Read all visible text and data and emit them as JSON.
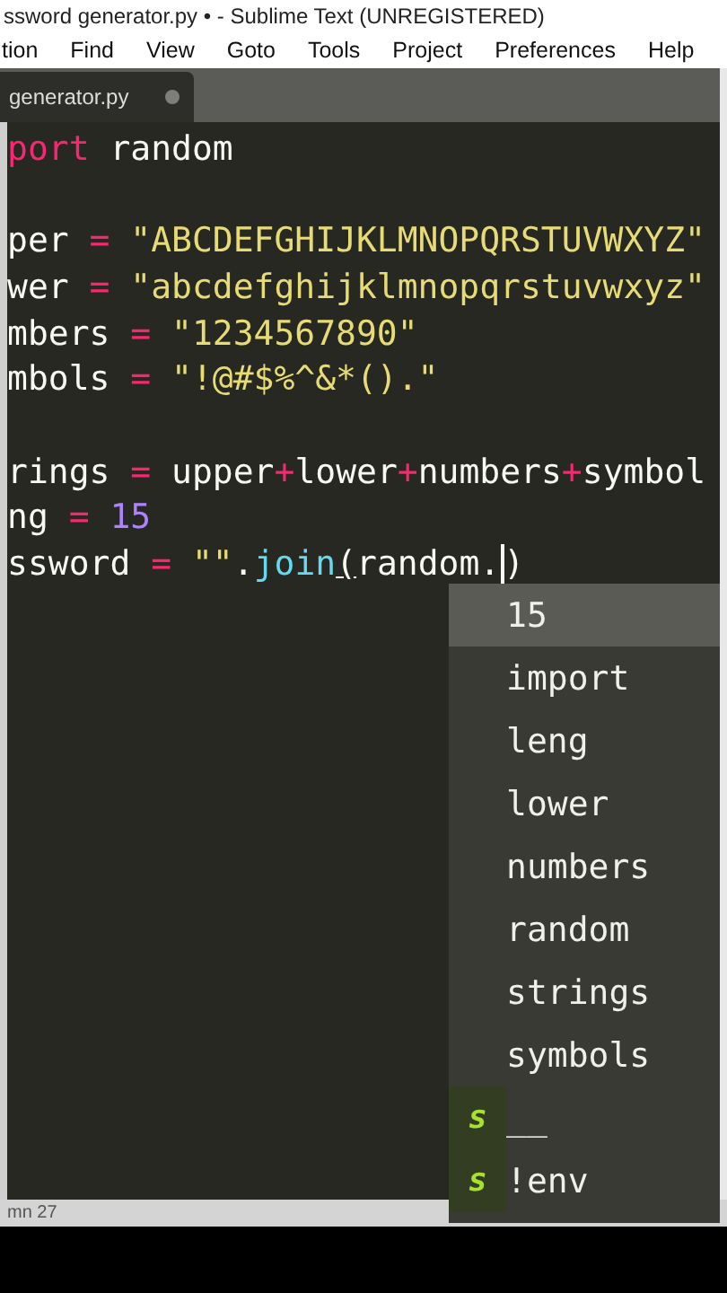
{
  "window": {
    "title": "ssword generator.py • - Sublime Text (UNREGISTERED)"
  },
  "menu": [
    "tion",
    "Find",
    "View",
    "Goto",
    "Tools",
    "Project",
    "Preferences",
    "Help"
  ],
  "tabs": [
    {
      "label": "generator.py",
      "selected": true,
      "modified": true
    }
  ],
  "code": {
    "lines": [
      {
        "kind": "code",
        "tokens": [
          {
            "kind": "keyword",
            "text": "port"
          },
          {
            "kind": "plain",
            "text": " random"
          }
        ]
      },
      {
        "kind": "blank"
      },
      {
        "kind": "code",
        "tokens": [
          {
            "kind": "plain",
            "text": "per "
          },
          {
            "kind": "operator",
            "text": "="
          },
          {
            "kind": "string",
            "text": " \"ABCDEFGHIJKLMNOPQRSTUVWXYZ\""
          }
        ]
      },
      {
        "kind": "code",
        "tokens": [
          {
            "kind": "plain",
            "text": "wer "
          },
          {
            "kind": "operator",
            "text": "="
          },
          {
            "kind": "string",
            "text": " \"abcdefghijklmnopqrstuvwxyz\""
          }
        ]
      },
      {
        "kind": "code",
        "tokens": [
          {
            "kind": "plain",
            "text": "mbers "
          },
          {
            "kind": "operator",
            "text": "="
          },
          {
            "kind": "string",
            "text": " \"1234567890\""
          }
        ]
      },
      {
        "kind": "code",
        "tokens": [
          {
            "kind": "plain",
            "text": "mbols "
          },
          {
            "kind": "operator",
            "text": "="
          },
          {
            "kind": "string",
            "text": " \"!@#$%^&*().\""
          }
        ]
      },
      {
        "kind": "blank"
      },
      {
        "kind": "code",
        "tokens": [
          {
            "kind": "plain",
            "text": "rings "
          },
          {
            "kind": "operator",
            "text": "="
          },
          {
            "kind": "plain",
            "text": " upper"
          },
          {
            "kind": "operator",
            "text": "+"
          },
          {
            "kind": "plain",
            "text": "lower"
          },
          {
            "kind": "operator",
            "text": "+"
          },
          {
            "kind": "plain",
            "text": "numbers"
          },
          {
            "kind": "operator",
            "text": "+"
          },
          {
            "kind": "plain",
            "text": "symbol"
          }
        ]
      },
      {
        "kind": "code",
        "tokens": [
          {
            "kind": "plain",
            "text": "ng "
          },
          {
            "kind": "operator",
            "text": "="
          },
          {
            "kind": "number",
            "text": " 15"
          }
        ]
      },
      {
        "kind": "code",
        "tokens": [
          {
            "kind": "plain",
            "text": "ssword "
          },
          {
            "kind": "operator",
            "text": "="
          },
          {
            "kind": "string",
            "text": " \"\""
          },
          {
            "kind": "plain",
            "text": "."
          },
          {
            "kind": "function",
            "text": "join"
          },
          {
            "kind": "bracket",
            "text": "("
          },
          {
            "kind": "plain",
            "text": "random.",
            "caret_after": true
          },
          {
            "kind": "plain",
            "text": ")"
          }
        ]
      }
    ]
  },
  "autocomplete": [
    {
      "label": "15",
      "kind": "word",
      "selected": true
    },
    {
      "label": "import",
      "kind": "word",
      "selected": false
    },
    {
      "label": "leng",
      "kind": "word",
      "selected": false
    },
    {
      "label": "lower",
      "kind": "word",
      "selected": false
    },
    {
      "label": "numbers",
      "kind": "word",
      "selected": false
    },
    {
      "label": "random",
      "kind": "word",
      "selected": false
    },
    {
      "label": "strings",
      "kind": "word",
      "selected": false
    },
    {
      "label": "symbols",
      "kind": "word",
      "selected": false
    },
    {
      "label": "__",
      "kind": "snippet",
      "badge": "s",
      "selected": false
    },
    {
      "label": "!env",
      "kind": "snippet",
      "badge": "s",
      "selected": false
    }
  ],
  "status_bar": {
    "text": "mn 27"
  }
}
